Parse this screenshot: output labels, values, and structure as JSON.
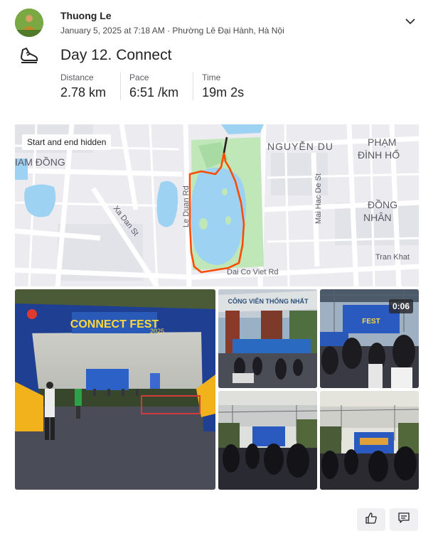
{
  "header": {
    "athlete_name": "Thuong Le",
    "meta": "January 5, 2025 at 7:18 AM · Phường Lê Đại Hành, Hà Nội",
    "expand_icon": "chevron-down-icon",
    "activity_icon": "running-shoe-icon"
  },
  "activity": {
    "title": "Day 12. Connect",
    "stats": [
      {
        "label": "Distance",
        "value": "2.78 km"
      },
      {
        "label": "Pace",
        "value": "6:51 /km"
      },
      {
        "label": "Time",
        "value": "19m 2s"
      }
    ]
  },
  "map": {
    "badge": "Start and end hidden",
    "route_color": "#fc4c02",
    "labels": [
      "NGUYỄN DU",
      "PHẠM",
      "ĐÌNH HỔ",
      "ĐỒNG",
      "NHÂN",
      "IAM ĐỒNG",
      "Le Duan Rd",
      "Mai Hac De St",
      "Xa Dan St",
      "Tran Khat",
      "Dai Co Viet Rd"
    ]
  },
  "media": {
    "video_duration": "0:06",
    "main_gate_text": "CONNECT FEST",
    "main_gate_year": "2025",
    "park_sign": "CÔNG VIÊN THỐNG NHẤT"
  },
  "actions": {
    "kudos_icon": "thumbs-up-icon",
    "comment_icon": "comment-icon"
  }
}
